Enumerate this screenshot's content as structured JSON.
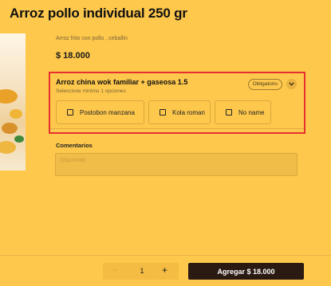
{
  "product": {
    "title": "Arroz pollo individual 250 gr",
    "description": "Arroz frito con pollo , ceballin",
    "price": "$ 18.000"
  },
  "option_group": {
    "title": "Arroz china wok familiar + gaseosa 1.5",
    "subtitle": "Seleccione minimo 1 opciones",
    "badge": "Obligatorio",
    "options": [
      {
        "label": "Postobon manzana",
        "checked": false
      },
      {
        "label": "Kola roman",
        "checked": false
      },
      {
        "label": "No name",
        "checked": false
      }
    ]
  },
  "comments": {
    "label": "Comentarios",
    "placeholder": "(Opcional)"
  },
  "footer": {
    "minus": "−",
    "quantity": "1",
    "plus": "+",
    "add_button": "Agregar $ 18.000"
  },
  "colors": {
    "background": "#fec84d",
    "highlight_border": "#e53030",
    "add_button": "#2a1a12"
  }
}
